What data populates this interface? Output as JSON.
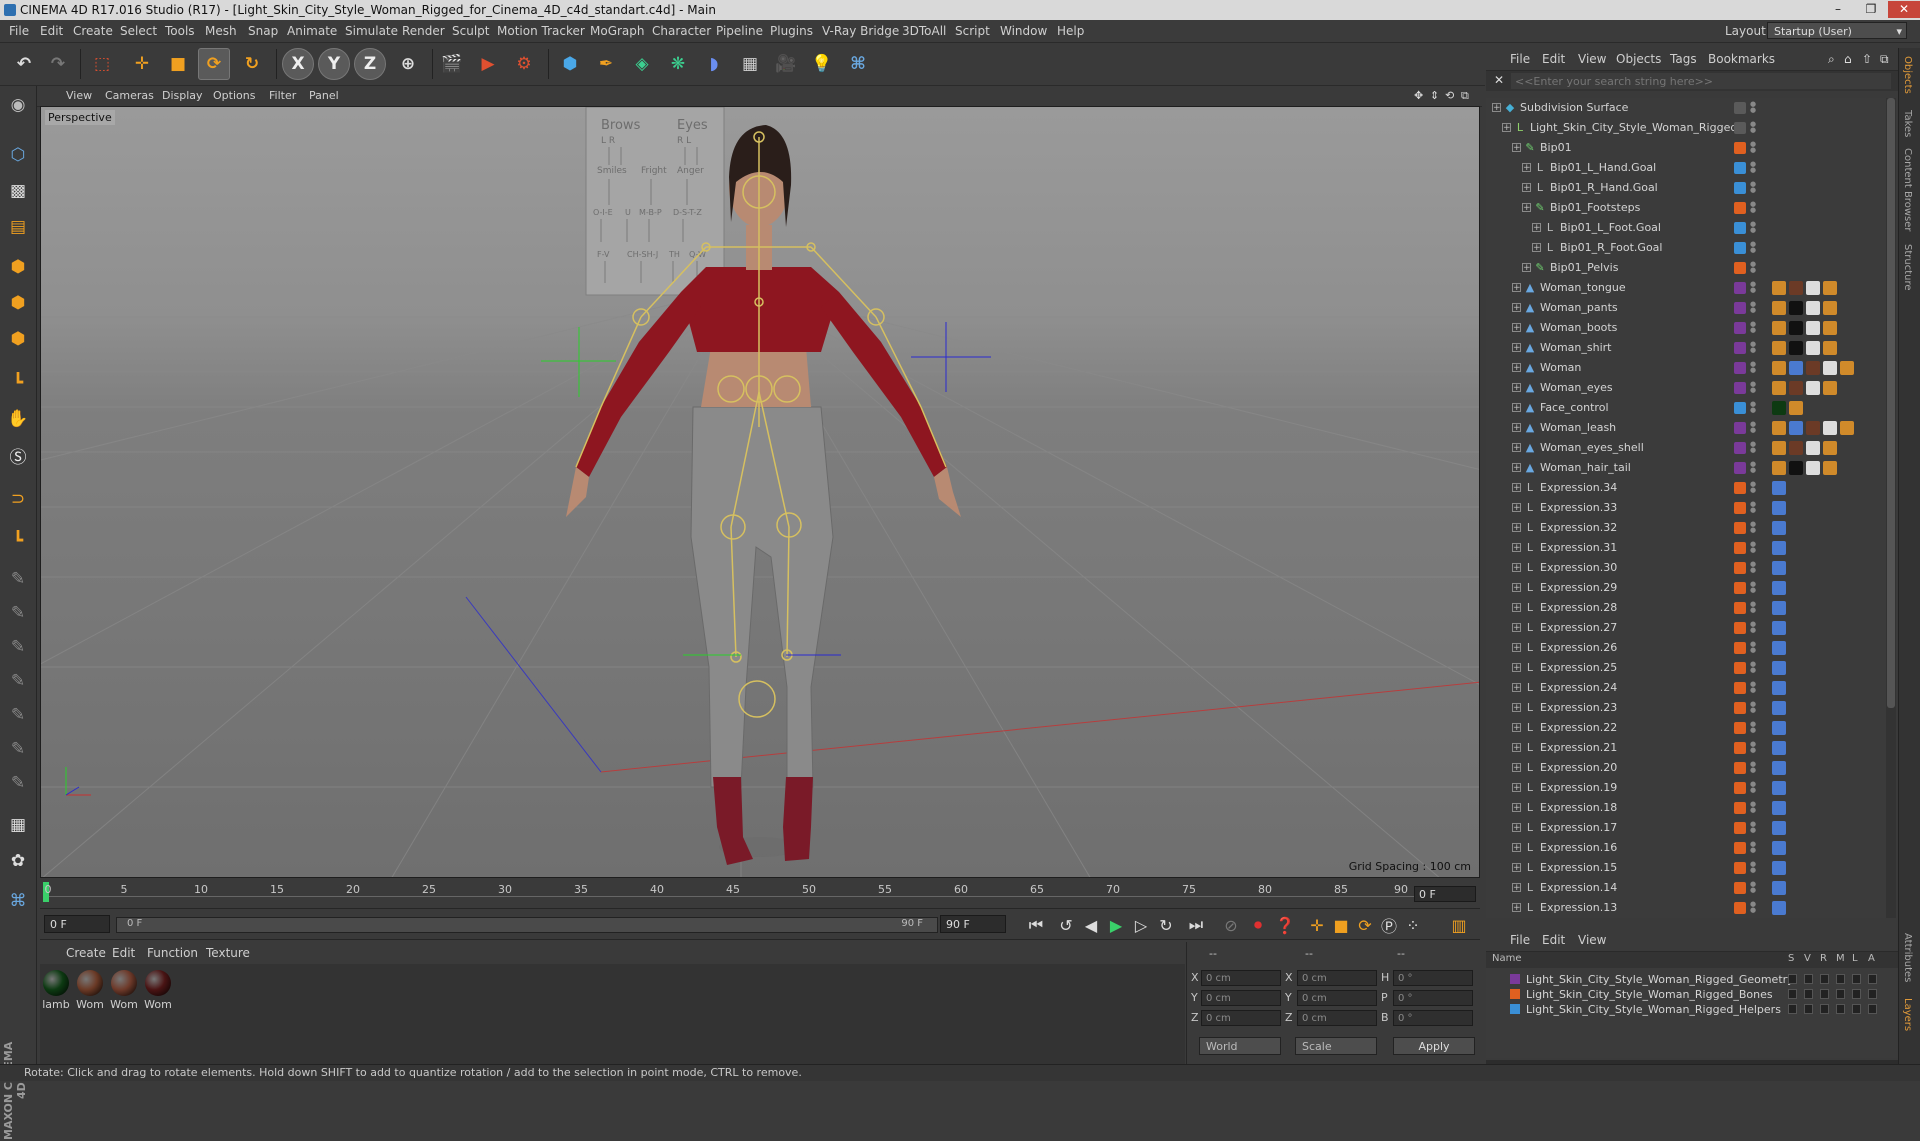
{
  "window": {
    "title": "CINEMA 4D R17.016 Studio (R17) - [Light_Skin_City_Style_Woman_Rigged_for_Cinema_4D_c4d_standart.c4d] - Main",
    "controls": [
      "–",
      "❐",
      "✕"
    ]
  },
  "menubar": {
    "items": [
      "File",
      "Edit",
      "Create",
      "Select",
      "Tools",
      "Mesh",
      "Snap",
      "Animate",
      "Simulate",
      "Render",
      "Sculpt",
      "Motion Tracker",
      "MoGraph",
      "Character",
      "Pipeline",
      "Plugins",
      "V-Ray Bridge",
      "3DToAll",
      "Script",
      "Window",
      "Help"
    ],
    "layout_label": "Layout:",
    "layout_value": "Startup (User)"
  },
  "toolbar": {
    "axis_x": "X",
    "axis_y": "Y",
    "axis_z": "Z"
  },
  "viewport": {
    "menu": [
      "View",
      "Cameras",
      "Display",
      "Options",
      "Filter",
      "Panel"
    ],
    "label": "Perspective",
    "grid_spacing": "Grid Spacing : 100 cm",
    "face_control": {
      "headers": [
        "Brows",
        "Eyes"
      ],
      "sub1": [
        "L R",
        "R L"
      ],
      "labels1": [
        "Smiles",
        "Fright",
        "Anger"
      ],
      "labels2": [
        "O-I-E",
        "U",
        "M-B-P",
        "D-S-T-Z"
      ],
      "labels3": [
        "F-V",
        "CH-SH-J",
        "TH",
        "Q-W"
      ]
    }
  },
  "timeline": {
    "ticks": [
      "0",
      "5",
      "10",
      "15",
      "20",
      "25",
      "30",
      "35",
      "40",
      "45",
      "50",
      "55",
      "60",
      "65",
      "70",
      "75",
      "80",
      "85",
      "90"
    ],
    "current_frame": "0 F"
  },
  "transport": {
    "start": "0 F",
    "range_start": "0 F",
    "range_end": "90 F",
    "end": "90 F"
  },
  "material_manager": {
    "menu": [
      "Create",
      "Edit",
      "Function",
      "Texture"
    ],
    "materials": [
      {
        "name": "lamb",
        "color": "#0d3a12"
      },
      {
        "name": "Wom",
        "color": "#6b3a26"
      },
      {
        "name": "Wom",
        "color": "#6e3a2a"
      },
      {
        "name": "Wom",
        "color": "#4a1414"
      }
    ]
  },
  "coordinates": {
    "headers": [
      "--",
      "--",
      "--"
    ],
    "rows": [
      {
        "a": "X",
        "av": "0 cm",
        "b": "X",
        "bv": "0 cm",
        "c": "H",
        "cv": "0 °"
      },
      {
        "a": "Y",
        "av": "0 cm",
        "b": "Y",
        "bv": "0 cm",
        "c": "P",
        "cv": "0 °"
      },
      {
        "a": "Z",
        "av": "0 cm",
        "b": "Z",
        "bv": "0 cm",
        "c": "B",
        "cv": "0 °"
      }
    ],
    "mode": "World",
    "scale": "Scale",
    "apply": "Apply"
  },
  "statusbar": {
    "text": "Rotate: Click and drag to rotate elements. Hold down SHIFT to add to quantize rotation / add to the selection in point mode, CTRL to remove."
  },
  "object_manager": {
    "menu": [
      "File",
      "Edit",
      "View",
      "Objects",
      "Tags",
      "Bookmarks"
    ],
    "search_placeholder": "<<Enter your search string here>>",
    "objects": [
      {
        "name": "Subdivision Surface",
        "indent": 0,
        "icon": "◆",
        "icon_color": "#46b0d6",
        "layer": "",
        "tags": []
      },
      {
        "name": "Light_Skin_City_Style_Woman_Rigged",
        "indent": 1,
        "icon": "L",
        "icon_color": "#8fd06a",
        "layer": "",
        "tags": []
      },
      {
        "name": "Bip01",
        "indent": 2,
        "icon": "✎",
        "icon_color": "#6fcf6f",
        "layer": "#e06020",
        "tags": []
      },
      {
        "name": "Bip01_L_Hand.Goal",
        "indent": 3,
        "icon": "L",
        "icon_color": "#b8b8b8",
        "layer": "#3a8fd6",
        "tags": []
      },
      {
        "name": "Bip01_R_Hand.Goal",
        "indent": 3,
        "icon": "L",
        "icon_color": "#b8b8b8",
        "layer": "#3a8fd6",
        "tags": []
      },
      {
        "name": "Bip01_Footsteps",
        "indent": 3,
        "icon": "✎",
        "icon_color": "#6fcf6f",
        "layer": "#e06020",
        "tags": []
      },
      {
        "name": "Bip01_L_Foot.Goal",
        "indent": 4,
        "icon": "L",
        "icon_color": "#b8b8b8",
        "layer": "#3a8fd6",
        "tags": []
      },
      {
        "name": "Bip01_R_Foot.Goal",
        "indent": 4,
        "icon": "L",
        "icon_color": "#b8b8b8",
        "layer": "#3a8fd6",
        "tags": []
      },
      {
        "name": "Bip01_Pelvis",
        "indent": 3,
        "icon": "✎",
        "icon_color": "#6fcf6f",
        "layer": "#e06020",
        "tags": []
      },
      {
        "name": "Woman_tongue",
        "indent": 2,
        "icon": "▲",
        "icon_color": "#6aa8e0",
        "layer": "#7a3a9a",
        "tags": [
          "#d08a2a",
          "#6b3a26",
          "#dddddd",
          "#d08a2a"
        ]
      },
      {
        "name": "Woman_pants",
        "indent": 2,
        "icon": "▲",
        "icon_color": "#6aa8e0",
        "layer": "#7a3a9a",
        "tags": [
          "#d08a2a",
          "#111111",
          "#dddddd",
          "#d08a2a"
        ]
      },
      {
        "name": "Woman_boots",
        "indent": 2,
        "icon": "▲",
        "icon_color": "#6aa8e0",
        "layer": "#7a3a9a",
        "tags": [
          "#d08a2a",
          "#111111",
          "#dddddd",
          "#d08a2a"
        ]
      },
      {
        "name": "Woman_shirt",
        "indent": 2,
        "icon": "▲",
        "icon_color": "#6aa8e0",
        "layer": "#7a3a9a",
        "tags": [
          "#d08a2a",
          "#111111",
          "#dddddd",
          "#d08a2a"
        ]
      },
      {
        "name": "Woman",
        "indent": 2,
        "icon": "▲",
        "icon_color": "#6aa8e0",
        "layer": "#7a3a9a",
        "tags": [
          "#d08a2a",
          "#4a7ad0",
          "#6b3a26",
          "#dddddd",
          "#d08a2a"
        ]
      },
      {
        "name": "Woman_eyes",
        "indent": 2,
        "icon": "▲",
        "icon_color": "#6aa8e0",
        "layer": "#7a3a9a",
        "tags": [
          "#d08a2a",
          "#6b3a26",
          "#dddddd",
          "#d08a2a"
        ]
      },
      {
        "name": "Face_control",
        "indent": 2,
        "icon": "▲",
        "icon_color": "#6aa8e0",
        "layer": "#3a8fd6",
        "tags": [
          "#0d3a12",
          "#d08a2a"
        ]
      },
      {
        "name": "Woman_leash",
        "indent": 2,
        "icon": "▲",
        "icon_color": "#6aa8e0",
        "layer": "#7a3a9a",
        "tags": [
          "#d08a2a",
          "#4a7ad0",
          "#6b3a26",
          "#dddddd",
          "#d08a2a"
        ]
      },
      {
        "name": "Woman_eyes_shell",
        "indent": 2,
        "icon": "▲",
        "icon_color": "#6aa8e0",
        "layer": "#7a3a9a",
        "tags": [
          "#d08a2a",
          "#6b3a26",
          "#dddddd",
          "#d08a2a"
        ]
      },
      {
        "name": "Woman_hair_tail",
        "indent": 2,
        "icon": "▲",
        "icon_color": "#6aa8e0",
        "layer": "#7a3a9a",
        "tags": [
          "#d08a2a",
          "#111111",
          "#dddddd",
          "#d08a2a"
        ]
      },
      {
        "name": "Expression.34",
        "indent": 2,
        "icon": "L",
        "icon_color": "#b8b8b8",
        "layer": "#e06020",
        "tags": [
          "#4a7ad0"
        ]
      },
      {
        "name": "Expression.33",
        "indent": 2,
        "icon": "L",
        "icon_color": "#b8b8b8",
        "layer": "#e06020",
        "tags": [
          "#4a7ad0"
        ]
      },
      {
        "name": "Expression.32",
        "indent": 2,
        "icon": "L",
        "icon_color": "#b8b8b8",
        "layer": "#e06020",
        "tags": [
          "#4a7ad0"
        ]
      },
      {
        "name": "Expression.31",
        "indent": 2,
        "icon": "L",
        "icon_color": "#b8b8b8",
        "layer": "#e06020",
        "tags": [
          "#4a7ad0"
        ]
      },
      {
        "name": "Expression.30",
        "indent": 2,
        "icon": "L",
        "icon_color": "#b8b8b8",
        "layer": "#e06020",
        "tags": [
          "#4a7ad0"
        ]
      },
      {
        "name": "Expression.29",
        "indent": 2,
        "icon": "L",
        "icon_color": "#b8b8b8",
        "layer": "#e06020",
        "tags": [
          "#4a7ad0"
        ]
      },
      {
        "name": "Expression.28",
        "indent": 2,
        "icon": "L",
        "icon_color": "#b8b8b8",
        "layer": "#e06020",
        "tags": [
          "#4a7ad0"
        ]
      },
      {
        "name": "Expression.27",
        "indent": 2,
        "icon": "L",
        "icon_color": "#b8b8b8",
        "layer": "#e06020",
        "tags": [
          "#4a7ad0"
        ]
      },
      {
        "name": "Expression.26",
        "indent": 2,
        "icon": "L",
        "icon_color": "#b8b8b8",
        "layer": "#e06020",
        "tags": [
          "#4a7ad0"
        ]
      },
      {
        "name": "Expression.25",
        "indent": 2,
        "icon": "L",
        "icon_color": "#b8b8b8",
        "layer": "#e06020",
        "tags": [
          "#4a7ad0"
        ]
      },
      {
        "name": "Expression.24",
        "indent": 2,
        "icon": "L",
        "icon_color": "#b8b8b8",
        "layer": "#e06020",
        "tags": [
          "#4a7ad0"
        ]
      },
      {
        "name": "Expression.23",
        "indent": 2,
        "icon": "L",
        "icon_color": "#b8b8b8",
        "layer": "#e06020",
        "tags": [
          "#4a7ad0"
        ]
      },
      {
        "name": "Expression.22",
        "indent": 2,
        "icon": "L",
        "icon_color": "#b8b8b8",
        "layer": "#e06020",
        "tags": [
          "#4a7ad0"
        ]
      },
      {
        "name": "Expression.21",
        "indent": 2,
        "icon": "L",
        "icon_color": "#b8b8b8",
        "layer": "#e06020",
        "tags": [
          "#4a7ad0"
        ]
      },
      {
        "name": "Expression.20",
        "indent": 2,
        "icon": "L",
        "icon_color": "#b8b8b8",
        "layer": "#e06020",
        "tags": [
          "#4a7ad0"
        ]
      },
      {
        "name": "Expression.19",
        "indent": 2,
        "icon": "L",
        "icon_color": "#b8b8b8",
        "layer": "#e06020",
        "tags": [
          "#4a7ad0"
        ]
      },
      {
        "name": "Expression.18",
        "indent": 2,
        "icon": "L",
        "icon_color": "#b8b8b8",
        "layer": "#e06020",
        "tags": [
          "#4a7ad0"
        ]
      },
      {
        "name": "Expression.17",
        "indent": 2,
        "icon": "L",
        "icon_color": "#b8b8b8",
        "layer": "#e06020",
        "tags": [
          "#4a7ad0"
        ]
      },
      {
        "name": "Expression.16",
        "indent": 2,
        "icon": "L",
        "icon_color": "#b8b8b8",
        "layer": "#e06020",
        "tags": [
          "#4a7ad0"
        ]
      },
      {
        "name": "Expression.15",
        "indent": 2,
        "icon": "L",
        "icon_color": "#b8b8b8",
        "layer": "#e06020",
        "tags": [
          "#4a7ad0"
        ]
      },
      {
        "name": "Expression.14",
        "indent": 2,
        "icon": "L",
        "icon_color": "#b8b8b8",
        "layer": "#e06020",
        "tags": [
          "#4a7ad0"
        ]
      },
      {
        "name": "Expression.13",
        "indent": 2,
        "icon": "L",
        "icon_color": "#b8b8b8",
        "layer": "#e06020",
        "tags": [
          "#4a7ad0"
        ]
      }
    ]
  },
  "layer_manager": {
    "menu": [
      "File",
      "Edit",
      "View"
    ],
    "columns": [
      "Name",
      "S",
      "V",
      "R",
      "M",
      "L",
      "A"
    ],
    "layers": [
      {
        "name": "Light_Skin_City_Style_Woman_Rigged_Geometry",
        "color": "#7a3a9a"
      },
      {
        "name": "Light_Skin_City_Style_Woman_Rigged_Bones",
        "color": "#e06020"
      },
      {
        "name": "Light_Skin_City_Style_Woman_Rigged_Helpers",
        "color": "#3a8fd6"
      }
    ]
  },
  "side_tabs": [
    "Objects",
    "Takes",
    "Content Browser",
    "Structure"
  ],
  "side_tabs_bottom": [
    "Attributes",
    "Layers"
  ],
  "brand": "MAXON CINEMA 4D"
}
